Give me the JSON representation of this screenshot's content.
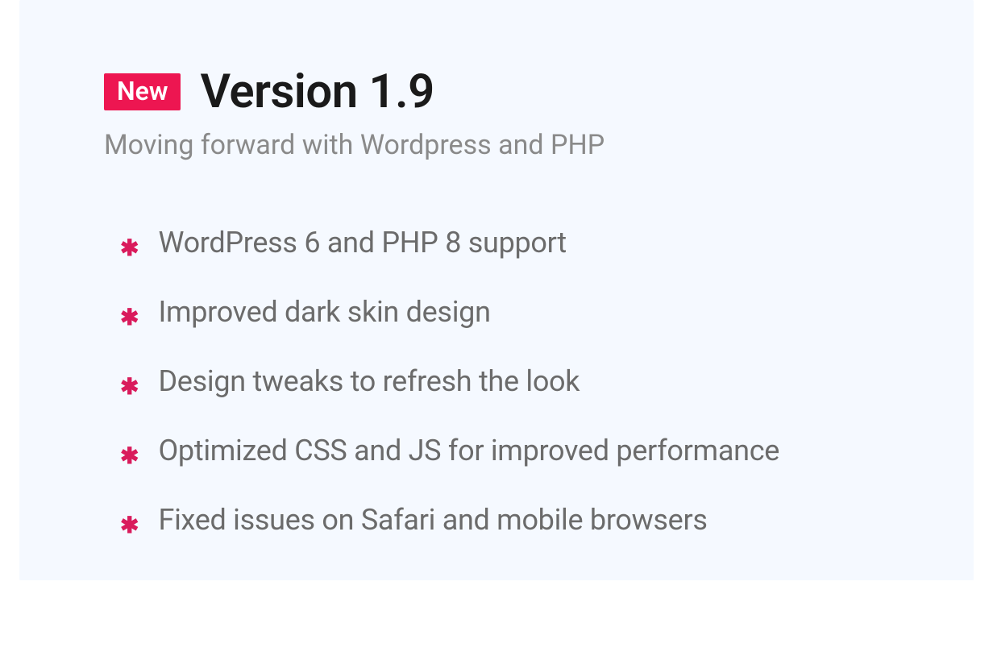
{
  "badge": "New",
  "title": "Version 1.9",
  "subtitle": "Moving forward with Wordpress and PHP",
  "features": [
    "WordPress 6 and PHP 8 support",
    "Improved dark skin design",
    "Design tweaks to refresh the look",
    "Optimized CSS and JS for improved performance",
    "Fixed issues on Safari and mobile browsers"
  ]
}
